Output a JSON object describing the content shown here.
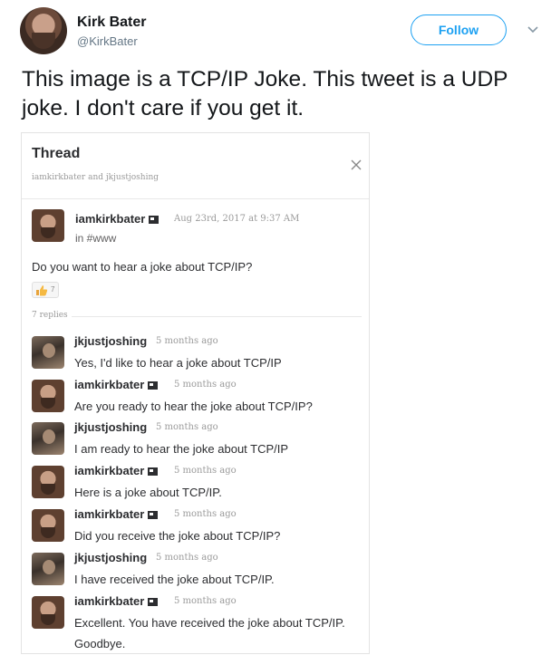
{
  "tweet": {
    "author_name": "Kirk Bater",
    "author_handle": "@KirkBater",
    "follow_label": "Follow",
    "text": "This image is a TCP/IP Joke.  This tweet is a UDP joke.  I don't care if you get it."
  },
  "thread": {
    "title": "Thread",
    "participants": "iamkirkbater and jkjustjoshing",
    "parent": {
      "author": "iamkirkbater",
      "timestamp": "Aug 23rd, 2017 at 9:37 AM",
      "channel": "in #www",
      "text": "Do you want to hear a joke about TCP/IP?",
      "reaction_count": "7"
    },
    "replies_label": "7 replies",
    "replies": [
      {
        "author": "jkjustjoshing",
        "time": "5 months ago",
        "text": "Yes, I'd like to hear a joke about TCP/IP"
      },
      {
        "author": "iamkirkbater",
        "time": "5 months ago",
        "text": "Are you ready to hear the joke about TCP/IP?"
      },
      {
        "author": "jkjustjoshing",
        "time": "5 months ago",
        "text": "I am ready to hear the joke about TCP/IP"
      },
      {
        "author": "iamkirkbater",
        "time": "5 months ago",
        "text": "Here is a joke about TCP/IP."
      },
      {
        "author": "iamkirkbater",
        "time": "5 months ago",
        "text": "Did you receive the joke about TCP/IP?"
      },
      {
        "author": "jkjustjoshing",
        "time": "5 months ago",
        "text": "I have received the joke about TCP/IP."
      },
      {
        "author": "iamkirkbater",
        "time": "5 months ago",
        "text": "Excellent.  You have received the joke about TCP/IP.  Goodbye."
      }
    ]
  },
  "colors": {
    "accent": "#1da1f2",
    "text_primary": "#14171a",
    "text_secondary": "#657786"
  }
}
